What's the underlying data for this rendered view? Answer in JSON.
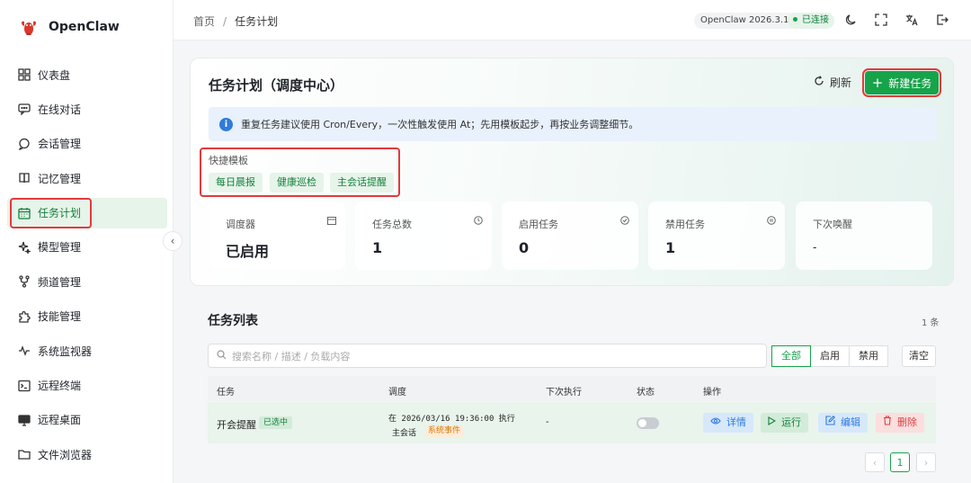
{
  "app": {
    "name": "OpenClaw",
    "version": "OpenClaw 2026.3.13",
    "status": "已连接",
    "brand_color": "#16a34a"
  },
  "sidebar": {
    "items": [
      {
        "label": "仪表盘",
        "icon": "dashboard-icon"
      },
      {
        "label": "在线对话",
        "icon": "chat-icon"
      },
      {
        "label": "会话管理",
        "icon": "session-icon"
      },
      {
        "label": "记忆管理",
        "icon": "book-icon"
      },
      {
        "label": "任务计划",
        "icon": "calendar-icon",
        "active": true
      },
      {
        "label": "模型管理",
        "icon": "sparkle-icon"
      },
      {
        "label": "频道管理",
        "icon": "branch-icon"
      },
      {
        "label": "技能管理",
        "icon": "puzzle-icon"
      },
      {
        "label": "系统监视器",
        "icon": "pulse-icon"
      },
      {
        "label": "远程终端",
        "icon": "terminal-icon"
      },
      {
        "label": "远程桌面",
        "icon": "monitor-icon"
      },
      {
        "label": "文件浏览器",
        "icon": "folder-icon"
      }
    ]
  },
  "breadcrumb": {
    "home": "首页",
    "sep": "/",
    "current": "任务计划"
  },
  "header": {
    "title": "任务计划（调度中心）",
    "refresh_label": "刷新",
    "new_task_label": "新建任务",
    "info_text": "重复任务建议使用 Cron/Every，一次性触发使用 At；先用模板起步，再按业务调整细节。"
  },
  "templates": {
    "label": "快捷模板",
    "items": [
      "每日晨报",
      "健康巡检",
      "主会话提醒"
    ]
  },
  "stats": [
    {
      "label": "调度器",
      "value": "已启用"
    },
    {
      "label": "任务总数",
      "value": "1"
    },
    {
      "label": "启用任务",
      "value": "0"
    },
    {
      "label": "禁用任务",
      "value": "1"
    },
    {
      "label": "下次唤醒",
      "value": "-"
    }
  ],
  "list": {
    "title": "任务列表",
    "count": "1 条",
    "search_placeholder": "搜索名称 / 描述 / 负载内容",
    "filters": [
      "全部",
      "启用",
      "禁用"
    ],
    "clear_label": "清空",
    "columns": [
      "任务",
      "调度",
      "下次执行",
      "状态",
      "操作"
    ],
    "rows": [
      {
        "name": "开会提醒",
        "selected_badge": "已选中",
        "schedule": "在 2026/03/16 19:36:00 执行",
        "session": "主会话",
        "event_badge": "系统事件",
        "next_run": "-",
        "enabled": false,
        "actions": [
          "详情",
          "运行",
          "编辑",
          "删除"
        ]
      }
    ],
    "pagination": {
      "prev": "‹",
      "current": "1",
      "next": "›"
    }
  }
}
